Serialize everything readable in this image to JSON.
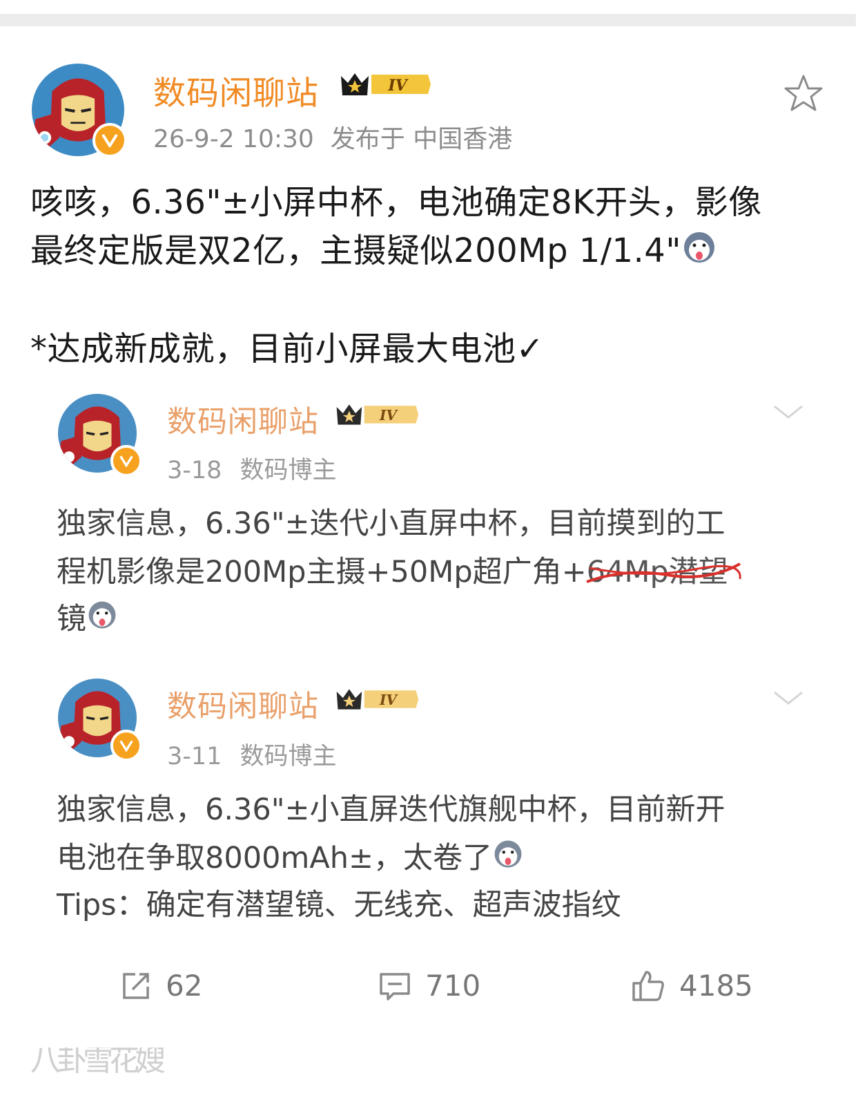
{
  "post": {
    "author": "数码闲聊站",
    "level_badge": "IV",
    "timestamp": "26-9-2 10:30",
    "location": "发布于 中国香港",
    "body_line1": "咳咳，6.36\"±小屏中杯，电池确定8K开头，影像",
    "body_line2": "最终定版是双2亿，主摄疑似200Mp 1/1.4\"",
    "body_line3": "*达成新成就，目前小屏最大电池✓"
  },
  "quoted": [
    {
      "author": "数码闲聊站",
      "level_badge": "IV",
      "date": "3-18",
      "role": "数码博主",
      "line1": "独家信息，6.36\"±迭代小直屏中杯，目前摸到的工",
      "line2_a": "程机影像是200Mp主摄+50Mp超广角+",
      "line2_struck": "64Mp潜望",
      "line3": "镜"
    },
    {
      "author": "数码闲聊站",
      "level_badge": "IV",
      "date": "3-11",
      "role": "数码博主",
      "line1": "独家信息，6.36\"±小直屏迭代旗舰中杯，目前新开",
      "line2": "电池在争取8000mAh±，太卷了",
      "line3": "Tips：确定有潜望镜、无线充、超声波指纹"
    }
  ],
  "actions": {
    "repost_count": "62",
    "comment_count": "710",
    "like_count": "4185"
  },
  "watermark": "八卦雪花嫂",
  "colors": {
    "author_name": "#f08b26",
    "quoted_author_name": "#e9a06a",
    "verified_badge": "#f6a21e",
    "strike_line": "#d9302c"
  },
  "icons": [
    "avatar-ironman",
    "verified-v-icon",
    "crown-level-icon",
    "star-icon",
    "husky-emoji",
    "chevron-down-icon",
    "repost-icon",
    "comment-icon",
    "like-icon"
  ]
}
